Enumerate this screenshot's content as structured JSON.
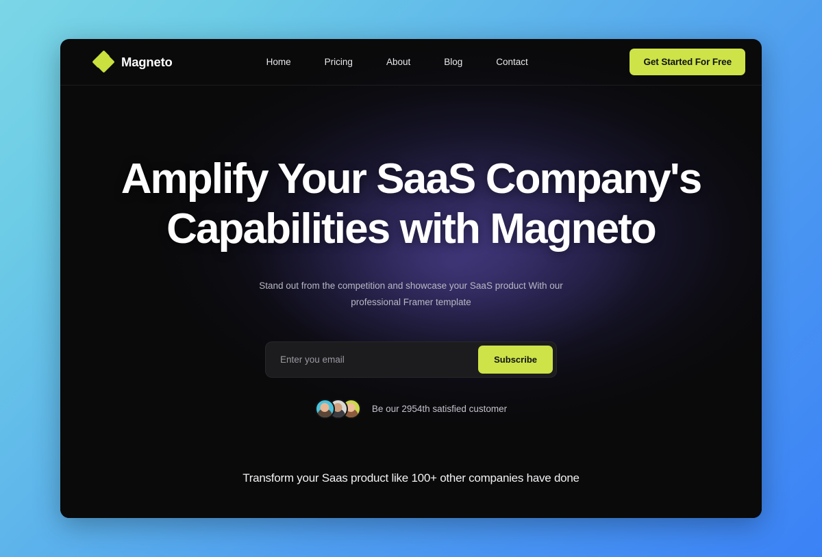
{
  "page": {
    "background_gradient_from": "#7bd6e6",
    "background_gradient_to": "#3b82f6",
    "card_background": "#0a0a0b",
    "accent_color": "#cde348",
    "glow_color": "#3e3678"
  },
  "header": {
    "brand_name": "Magneto",
    "logo_icon": "diamond-cluster-icon",
    "logo_color": "#c9e03e",
    "nav": [
      {
        "label": "Home"
      },
      {
        "label": "Pricing"
      },
      {
        "label": "About"
      },
      {
        "label": "Blog"
      },
      {
        "label": "Contact"
      }
    ],
    "cta_label": "Get Started For Free"
  },
  "hero": {
    "title_line_1": "Amplify Your SaaS Company's",
    "title_line_2": "Capabilities with Magneto",
    "subtitle": "Stand out from the competition and showcase your SaaS product With our professional Framer template",
    "form": {
      "email_placeholder": "Enter you email",
      "email_value": "",
      "submit_label": "Subscribe"
    },
    "social_proof": {
      "text": "Be our 2954th satisfied customer",
      "avatar_count": 3,
      "avatars": [
        {
          "name": "avatar-1",
          "background": "#4bc4dd"
        },
        {
          "name": "avatar-2",
          "background": "#d9d9d4"
        },
        {
          "name": "avatar-3",
          "background": "#ccd84a"
        }
      ]
    }
  },
  "bottom": {
    "tagline": "Transform your Saas product like 100+ other companies have done"
  }
}
